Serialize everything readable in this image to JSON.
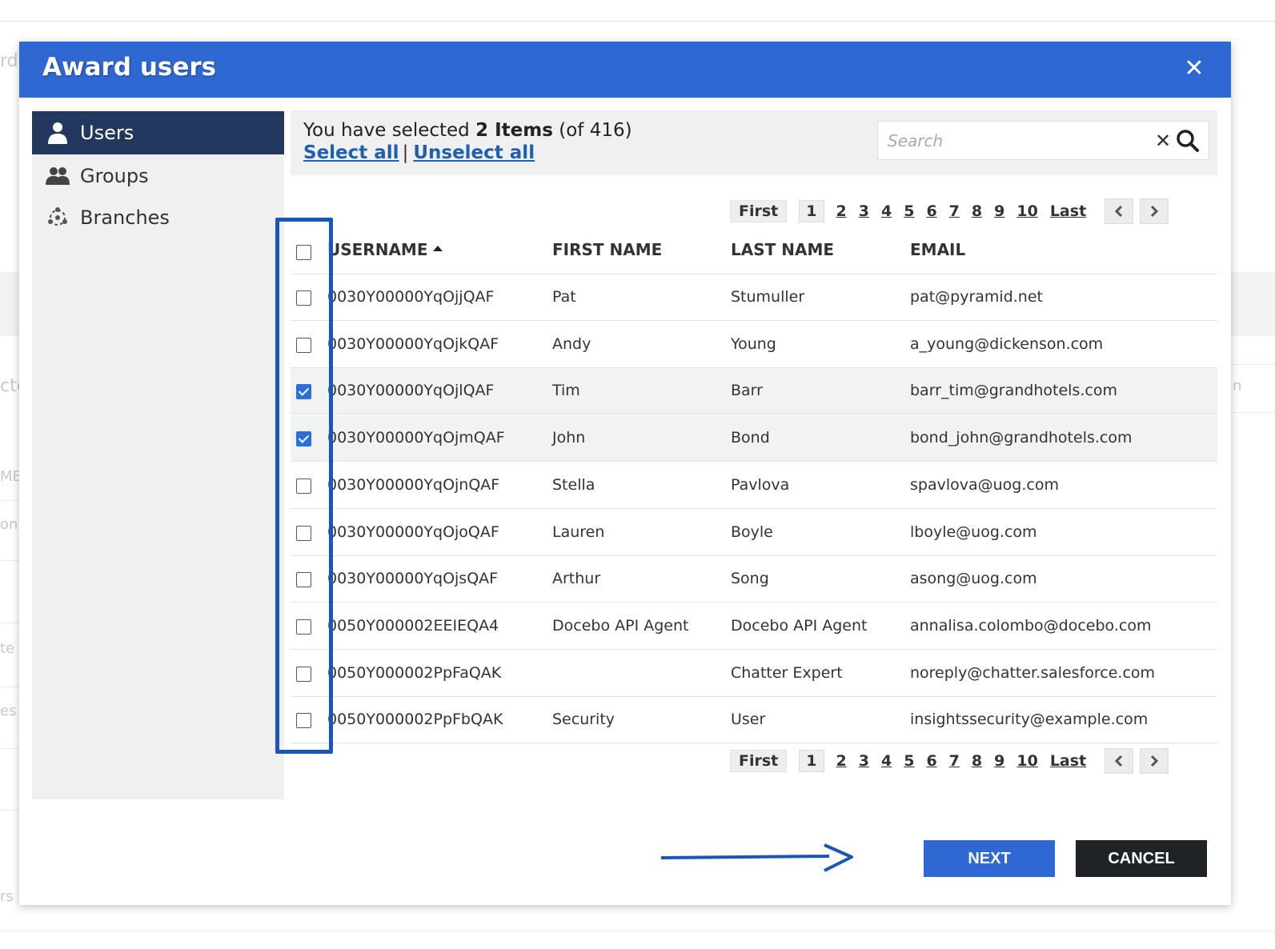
{
  "background": {
    "fragments": [
      "rd",
      "cte",
      "ME",
      "on",
      "te",
      "es",
      "rs",
      "n"
    ]
  },
  "dialog": {
    "title": "Award users",
    "close_icon": "close-icon",
    "accent_color": "#2f67d3",
    "sidebar": {
      "items": [
        {
          "label": "Users",
          "icon": "user-icon",
          "active": true
        },
        {
          "label": "Groups",
          "icon": "groups-icon",
          "active": false
        },
        {
          "label": "Branches",
          "icon": "branches-icon",
          "active": false
        }
      ]
    },
    "selection": {
      "prefix": "You have selected",
      "count": "2 Items",
      "total": "(of 416)",
      "select_all": "Select all",
      "separator": "|",
      "unselect_all": "Unselect all"
    },
    "search": {
      "placeholder": "Search",
      "value": ""
    },
    "pagination": {
      "first": "First",
      "pages": [
        "1",
        "2",
        "3",
        "4",
        "5",
        "6",
        "7",
        "8",
        "9",
        "10"
      ],
      "current": "1",
      "last": "Last"
    },
    "table": {
      "columns": [
        "USERNAME",
        "FIRST NAME",
        "LAST NAME",
        "EMAIL"
      ],
      "sort_column": "USERNAME",
      "rows": [
        {
          "checked": false,
          "username": "0030Y00000YqOjjQAF",
          "first": "Pat",
          "last": "Stumuller",
          "email": "pat@pyramid.net"
        },
        {
          "checked": false,
          "username": "0030Y00000YqOjkQAF",
          "first": "Andy",
          "last": "Young",
          "email": "a_young@dickenson.com"
        },
        {
          "checked": true,
          "username": "0030Y00000YqOjlQAF",
          "first": "Tim",
          "last": "Barr",
          "email": "barr_tim@grandhotels.com"
        },
        {
          "checked": true,
          "username": "0030Y00000YqOjmQAF",
          "first": "John",
          "last": "Bond",
          "email": "bond_john@grandhotels.com"
        },
        {
          "checked": false,
          "username": "0030Y00000YqOjnQAF",
          "first": "Stella",
          "last": "Pavlova",
          "email": "spavlova@uog.com"
        },
        {
          "checked": false,
          "username": "0030Y00000YqOjoQAF",
          "first": "Lauren",
          "last": "Boyle",
          "email": "lboyle@uog.com"
        },
        {
          "checked": false,
          "username": "0030Y00000YqOjsQAF",
          "first": "Arthur",
          "last": "Song",
          "email": "asong@uog.com"
        },
        {
          "checked": false,
          "username": "0050Y000002EEIEQA4",
          "first": "Docebo API Agent",
          "last": "Docebo API Agent",
          "email": "annalisa.colombo@docebo.com"
        },
        {
          "checked": false,
          "username": "0050Y000002PpFaQAK",
          "first": "",
          "last": "Chatter Expert",
          "email": "noreply@chatter.salesforce.com"
        },
        {
          "checked": false,
          "username": "0050Y000002PpFbQAK",
          "first": "Security",
          "last": "User",
          "email": "insightssecurity@example.com"
        }
      ]
    },
    "footer": {
      "next_label": "NEXT",
      "cancel_label": "CANCEL",
      "next_color": "#2f67d3",
      "cancel_color": "#1f2326"
    }
  }
}
